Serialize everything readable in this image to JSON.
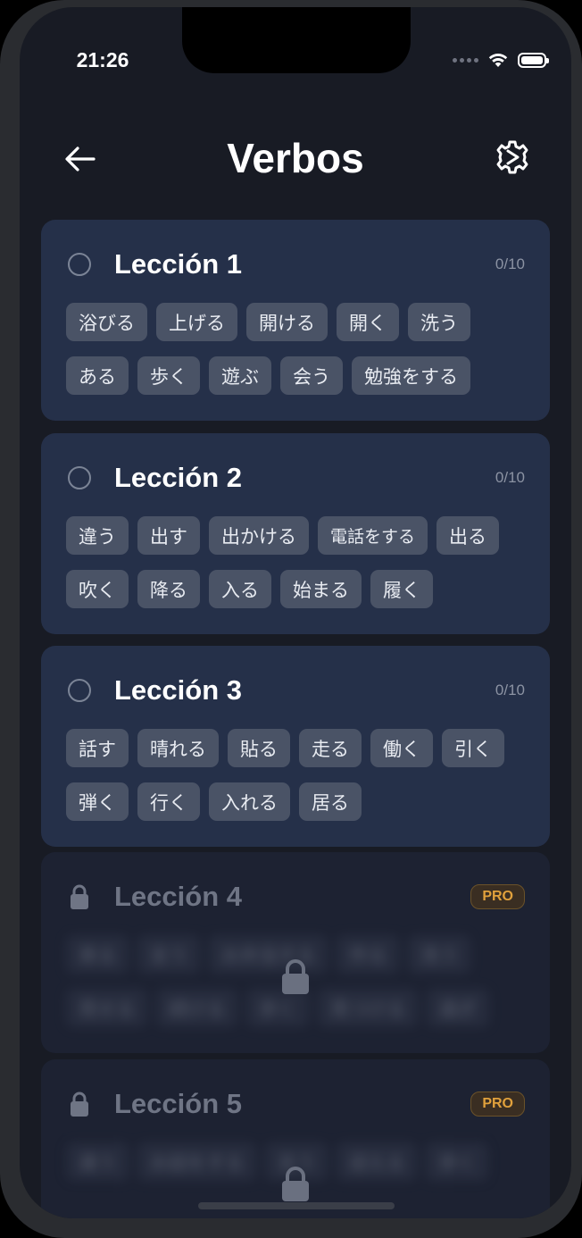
{
  "status_bar": {
    "time": "21:26"
  },
  "header": {
    "title": "Verbos"
  },
  "lessons": [
    {
      "title": "Lección 1",
      "progress": "0/10",
      "locked": false,
      "verbs": [
        "浴びる",
        "上げる",
        "開ける",
        "開く",
        "洗う",
        "ある",
        "歩く",
        "遊ぶ",
        "会う",
        "勉強をする"
      ]
    },
    {
      "title": "Lección 2",
      "progress": "0/10",
      "locked": false,
      "verbs": [
        "違う",
        "出す",
        "出かける",
        "電話をする",
        "出る",
        "吹く",
        "降る",
        "入る",
        "始まる",
        "履く"
      ]
    },
    {
      "title": "Lección 3",
      "progress": "0/10",
      "locked": false,
      "verbs": [
        "話す",
        "晴れる",
        "貼る",
        "走る",
        "働く",
        "引く",
        "弾く",
        "行く",
        "入れる",
        "居る"
      ]
    },
    {
      "title": "Lección 4",
      "badge": "PRO",
      "locked": true,
      "verbs": [
        "来る",
        "言う",
        "お弁当する",
        "作る",
        "洗う",
        "見せる",
        "続ける",
        "歩く",
        "見つける",
        "過ぎ"
      ]
    },
    {
      "title": "Lección 5",
      "badge": "PRO",
      "locked": true,
      "verbs": [
        "違う",
        "お話をする",
        "言う",
        "迎える",
        "歩く"
      ]
    }
  ],
  "icons": {
    "back": "arrow-left-icon",
    "settings": "gear-icon",
    "lock": "lock-icon"
  },
  "colors": {
    "background": "#181b24",
    "card": "#253049",
    "chip": "#4a5366",
    "pro_accent": "#e1a13c"
  }
}
